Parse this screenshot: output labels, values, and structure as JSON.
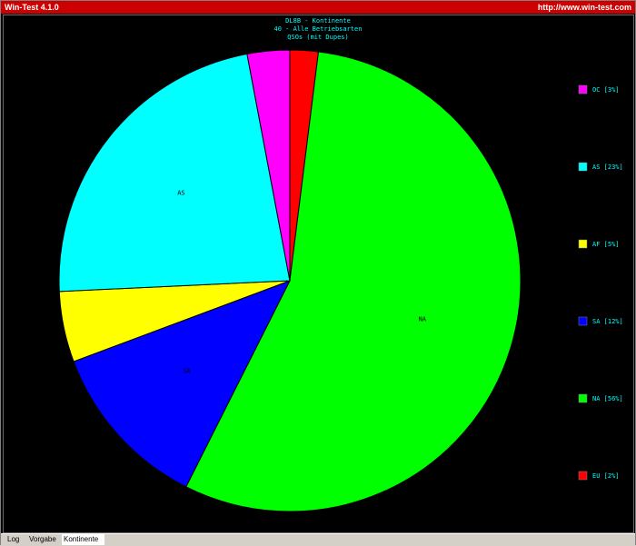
{
  "window": {
    "title": "Win-Test 4.1.0",
    "url": "http://www.win-test.com"
  },
  "chart_data": {
    "type": "pie",
    "title_lines": [
      "DL8B - Kontinente",
      "40 - Alle Betriebsarten",
      "QSOs (mit Dupes)"
    ],
    "slices": [
      {
        "label": "OC",
        "legend": "OC [3%]",
        "percent": 3,
        "color": "#ff00ff",
        "slice_label": ""
      },
      {
        "label": "AS",
        "legend": "AS [23%]",
        "percent": 23,
        "color": "#00ffff",
        "slice_label": "AS"
      },
      {
        "label": "AF",
        "legend": "AF [5%]",
        "percent": 5,
        "color": "#ffff00",
        "slice_label": ""
      },
      {
        "label": "SA",
        "legend": "SA [12%]",
        "percent": 12,
        "color": "#0000ff",
        "slice_label": "SA"
      },
      {
        "label": "NA",
        "legend": "NA [56%]",
        "percent": 56,
        "color": "#00ff00",
        "slice_label": "NA"
      },
      {
        "label": "EU",
        "legend": "EU [2%]",
        "percent": 2,
        "color": "#ff0000",
        "slice_label": ""
      }
    ],
    "legend_placement": "right"
  },
  "tabs": [
    {
      "label": "Log",
      "active": false
    },
    {
      "label": "Vorgabe",
      "active": false
    },
    {
      "label": "Kontinente",
      "active": true
    }
  ]
}
